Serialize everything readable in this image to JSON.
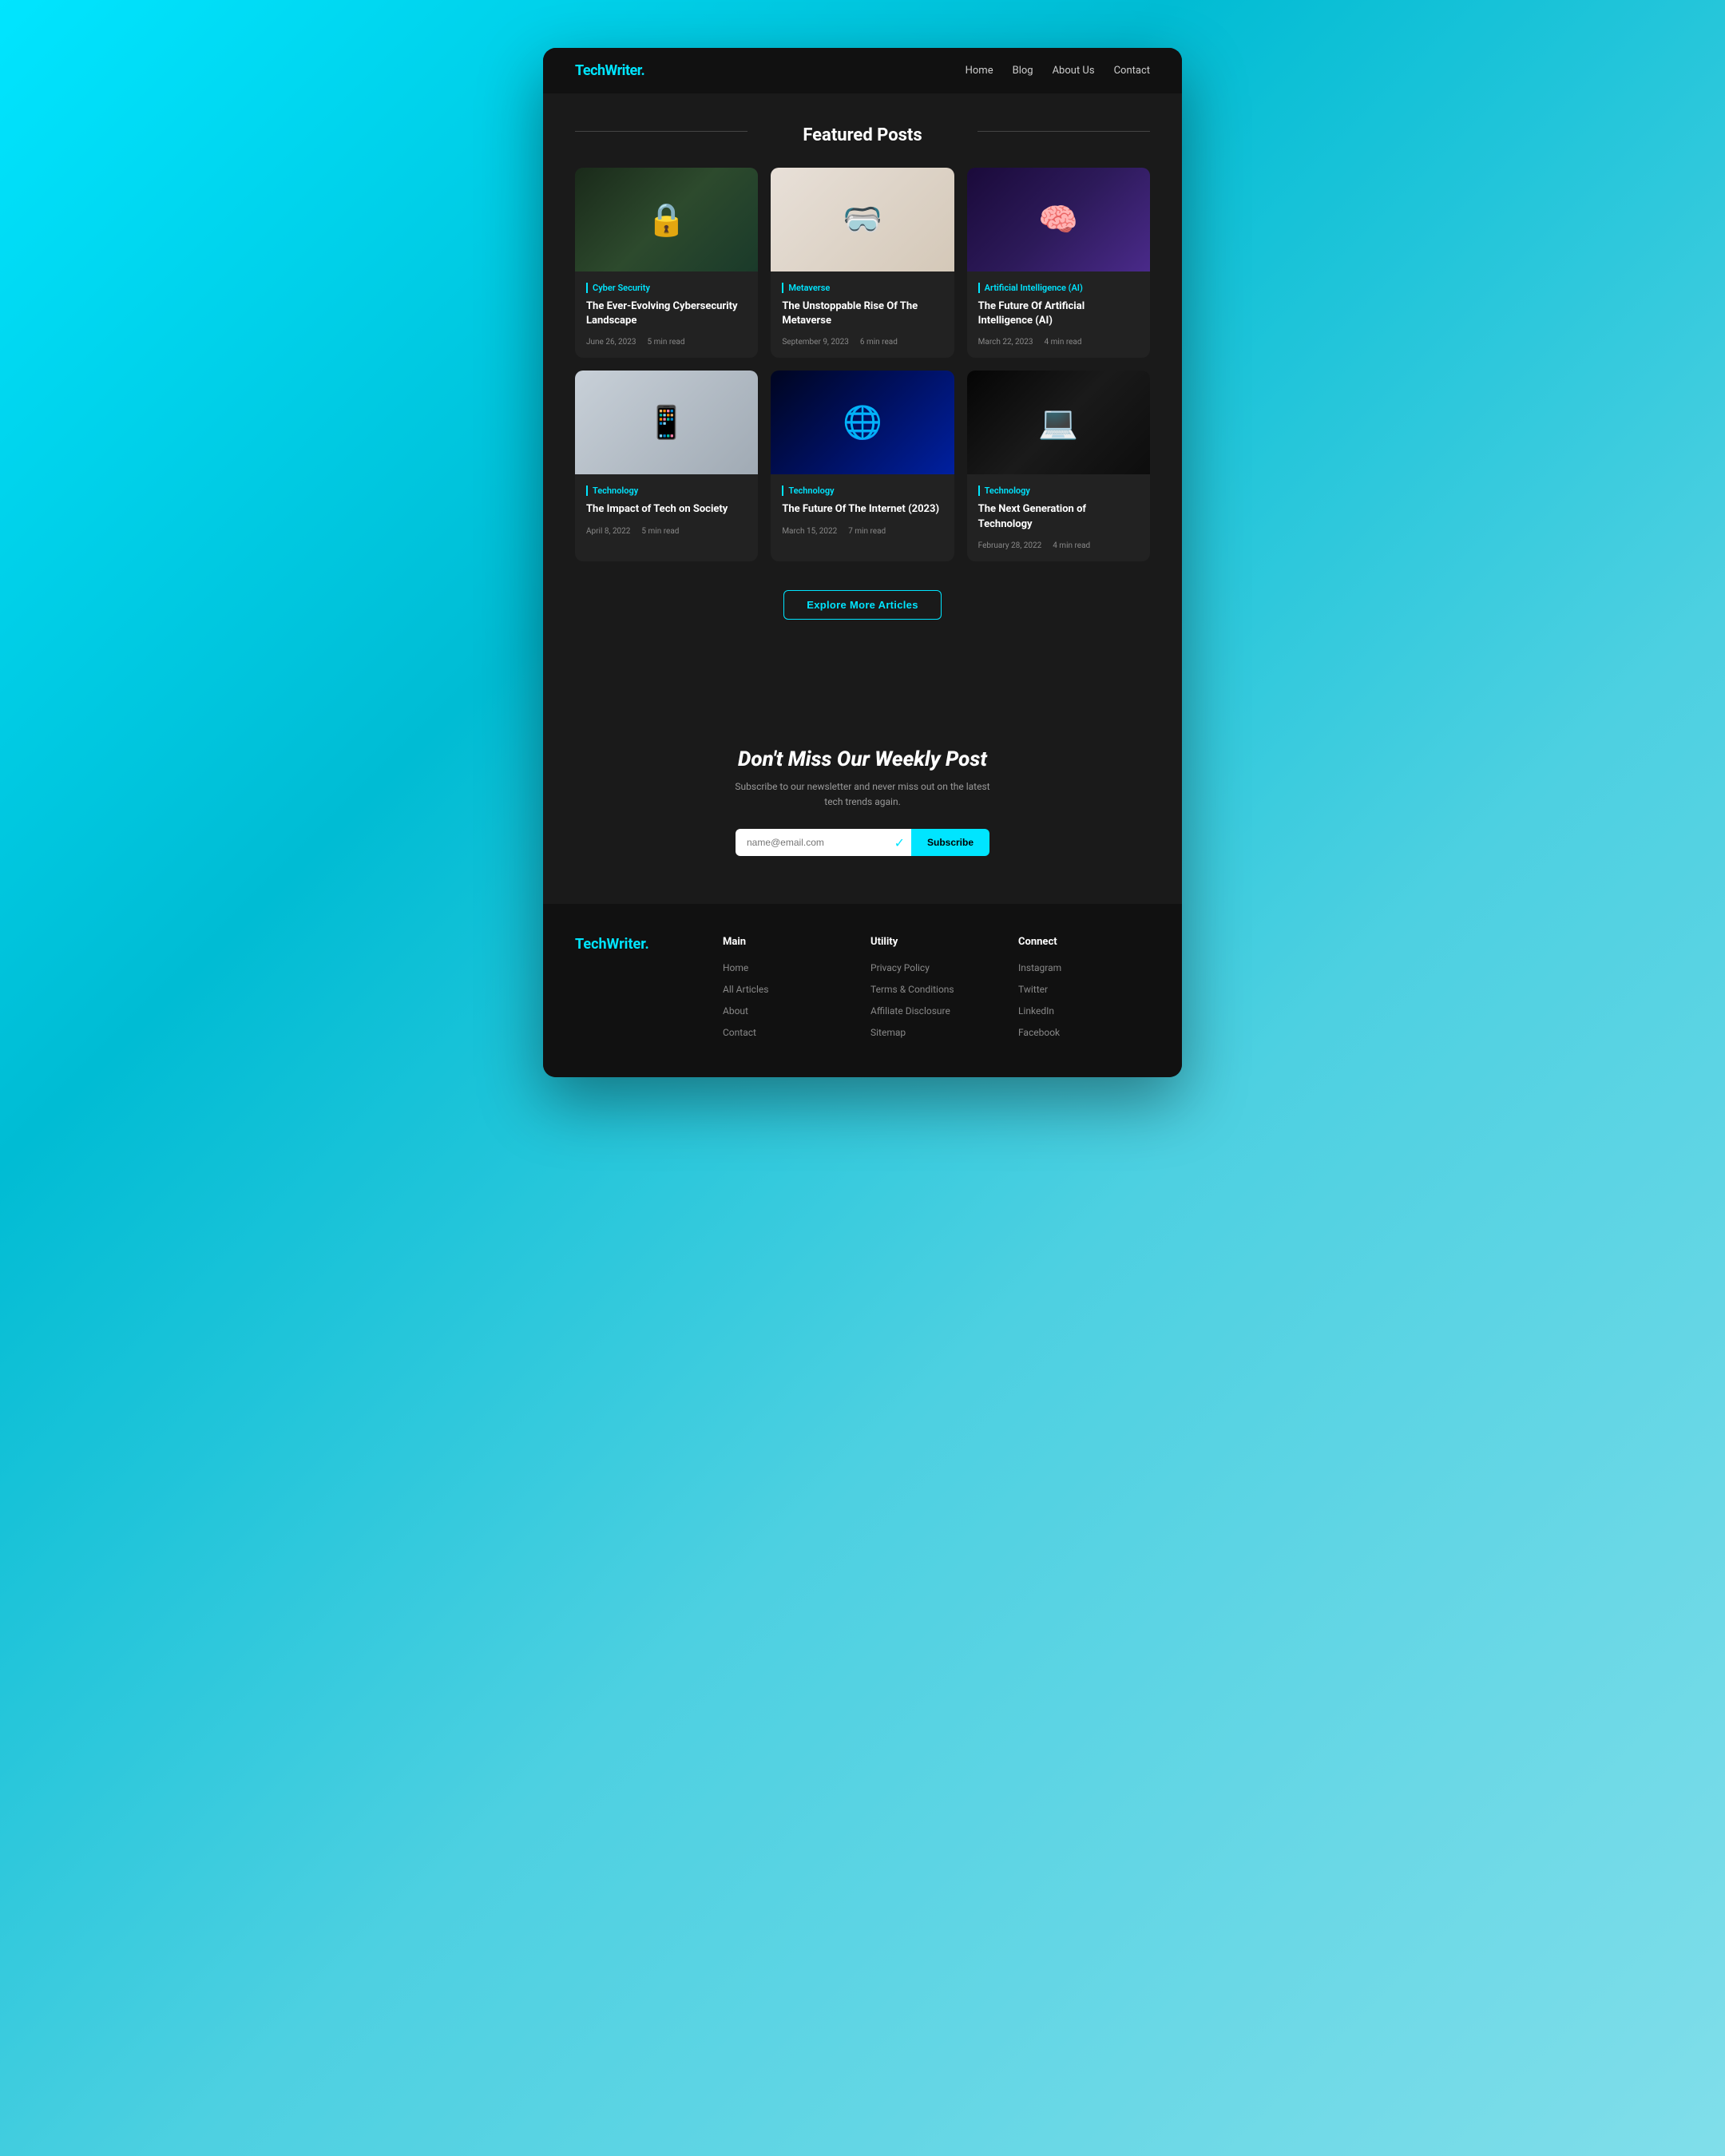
{
  "site": {
    "logo_text": "TechWriter",
    "logo_dot": "."
  },
  "nav": {
    "links": [
      {
        "label": "Home",
        "id": "home"
      },
      {
        "label": "Blog",
        "id": "blog"
      },
      {
        "label": "About Us",
        "id": "about"
      },
      {
        "label": "Contact",
        "id": "contact"
      }
    ]
  },
  "featured": {
    "section_title": "Featured Posts",
    "posts": [
      {
        "id": "cybersecurity",
        "category": "Cyber Security",
        "title": "The Ever-Evolving Cybersecurity Landscape",
        "date": "June 26, 2023",
        "read_time": "5 min read",
        "image_class": "img-cyber"
      },
      {
        "id": "metaverse",
        "category": "Metaverse",
        "title": "The Unstoppable Rise Of The Metaverse",
        "date": "September 9, 2023",
        "read_time": "6 min read",
        "image_class": "img-metaverse"
      },
      {
        "id": "ai",
        "category": "Artificial Intelligence (AI)",
        "title": "The Future Of Artificial Intelligence (AI)",
        "date": "March 22, 2023",
        "read_time": "4 min read",
        "image_class": "img-ai"
      },
      {
        "id": "tech-society",
        "category": "Technology",
        "title": "The Impact of Tech on Society",
        "date": "April 8, 2022",
        "read_time": "5 min read",
        "image_class": "img-tech-society"
      },
      {
        "id": "internet",
        "category": "Technology",
        "title": "The Future Of The Internet (2023)",
        "date": "March 15, 2022",
        "read_time": "7 min read",
        "image_class": "img-internet"
      },
      {
        "id": "next-gen",
        "category": "Technology",
        "title": "The Next Generation of Technology",
        "date": "February 28, 2022",
        "read_time": "4 min read",
        "image_class": "img-next-tech"
      }
    ],
    "explore_btn": "Explore More Articles"
  },
  "newsletter": {
    "title": "Don't Miss Our Weekly Post",
    "subtitle_line1": "Subscribe to our newsletter and never miss out on the latest",
    "subtitle_line2": "tech trends again.",
    "email_placeholder": "name@email.com",
    "subscribe_btn": "Subscribe"
  },
  "footer": {
    "logo_text": "TechWriter",
    "logo_dot": ".",
    "columns": [
      {
        "id": "main",
        "title": "Main",
        "links": [
          {
            "label": "Home"
          },
          {
            "label": "All Articles"
          },
          {
            "label": "About"
          },
          {
            "label": "Contact"
          }
        ]
      },
      {
        "id": "utility",
        "title": "Utility",
        "links": [
          {
            "label": "Privacy Policy"
          },
          {
            "label": "Terms & Conditions"
          },
          {
            "label": "Affiliate Disclosure"
          },
          {
            "label": "Sitemap"
          }
        ]
      },
      {
        "id": "connect",
        "title": "Connect",
        "links": [
          {
            "label": "Instagram"
          },
          {
            "label": "Twitter"
          },
          {
            "label": "LinkedIn"
          },
          {
            "label": "Facebook"
          }
        ]
      }
    ]
  }
}
